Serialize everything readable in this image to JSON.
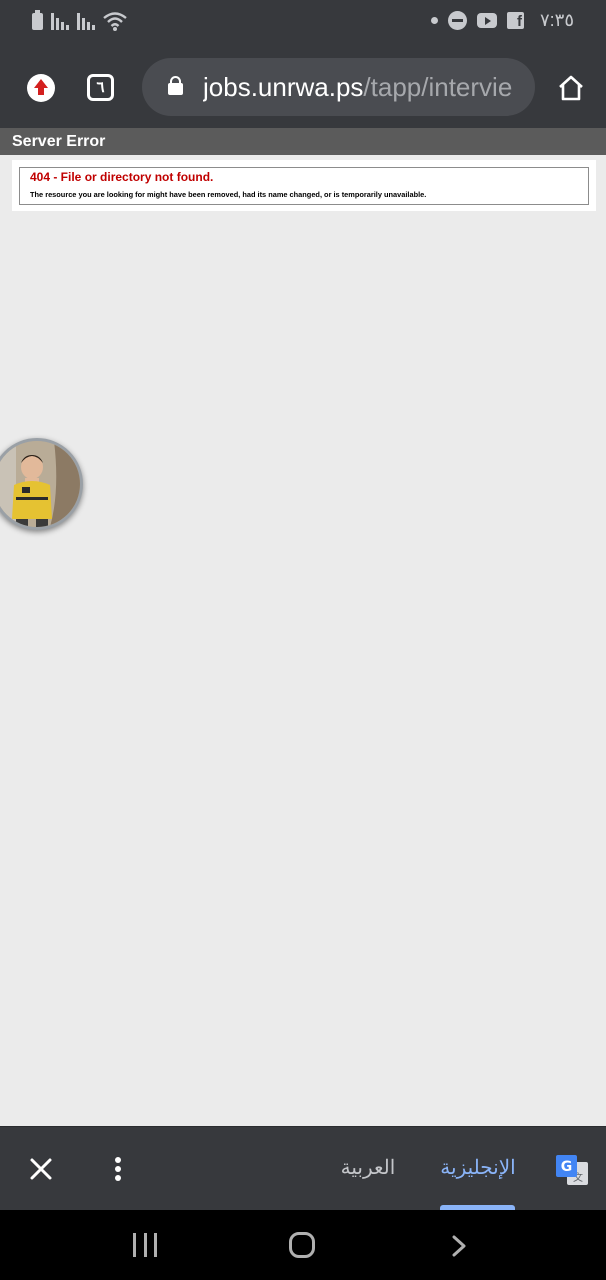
{
  "status_bar": {
    "time": "٧:٣٥",
    "icons": [
      "battery-icon",
      "signal-icon",
      "signal-icon",
      "wifi-icon",
      "notification-dot-icon",
      "data-saver-icon",
      "youtube-icon",
      "facebook-icon"
    ]
  },
  "browser": {
    "tab_count": "٦",
    "url_domain": "jobs.unrwa.ps",
    "url_path": "/tapp/intervie",
    "icons": [
      "upload-icon",
      "tabs-icon",
      "lock-icon",
      "home-icon"
    ]
  },
  "page": {
    "header": "Server Error",
    "error_title": "404 - File or directory not found.",
    "error_description": "The resource you are looking for might have been removed, had its name changed, or is temporarily unavailable."
  },
  "translate_bar": {
    "source_language": "العربية",
    "target_language": "الإنجليزية",
    "selected": "target",
    "icons": [
      "close-icon",
      "more-vert-icon",
      "google-translate-icon"
    ]
  },
  "colors": {
    "chrome_dark": "#37393d",
    "url_bar": "#4a4c51",
    "accent_blue": "#8ab4f8",
    "error_red": "#c00000",
    "header_gray": "#5b5b5b",
    "page_bg": "#ebebeb"
  }
}
